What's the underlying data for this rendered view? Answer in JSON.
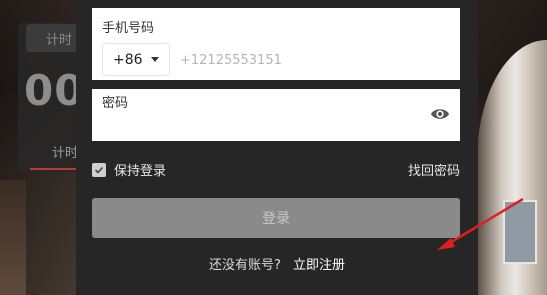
{
  "background": {
    "timer_tab": "计时",
    "timer_number": "00",
    "timer_sub": "计时"
  },
  "form": {
    "phone_label": "手机号码",
    "country_code": "+86",
    "phone_placeholder": "+12125553151",
    "password_label": "密码",
    "remember_label": "保持登录",
    "remember_checked": true,
    "forgot_label": "找回密码",
    "login_label": "登录",
    "no_account_text": "还没有账号?",
    "register_label": "立即注册"
  },
  "colors": {
    "modal_bg": "#262626",
    "login_button_disabled": "#8a8a8a",
    "annotation_arrow": "#e02020"
  },
  "icons": {
    "password_toggle": "eye-icon",
    "country_dropdown": "chevron-down-icon",
    "remember_check": "check-icon",
    "annotation": "arrow-icon"
  }
}
